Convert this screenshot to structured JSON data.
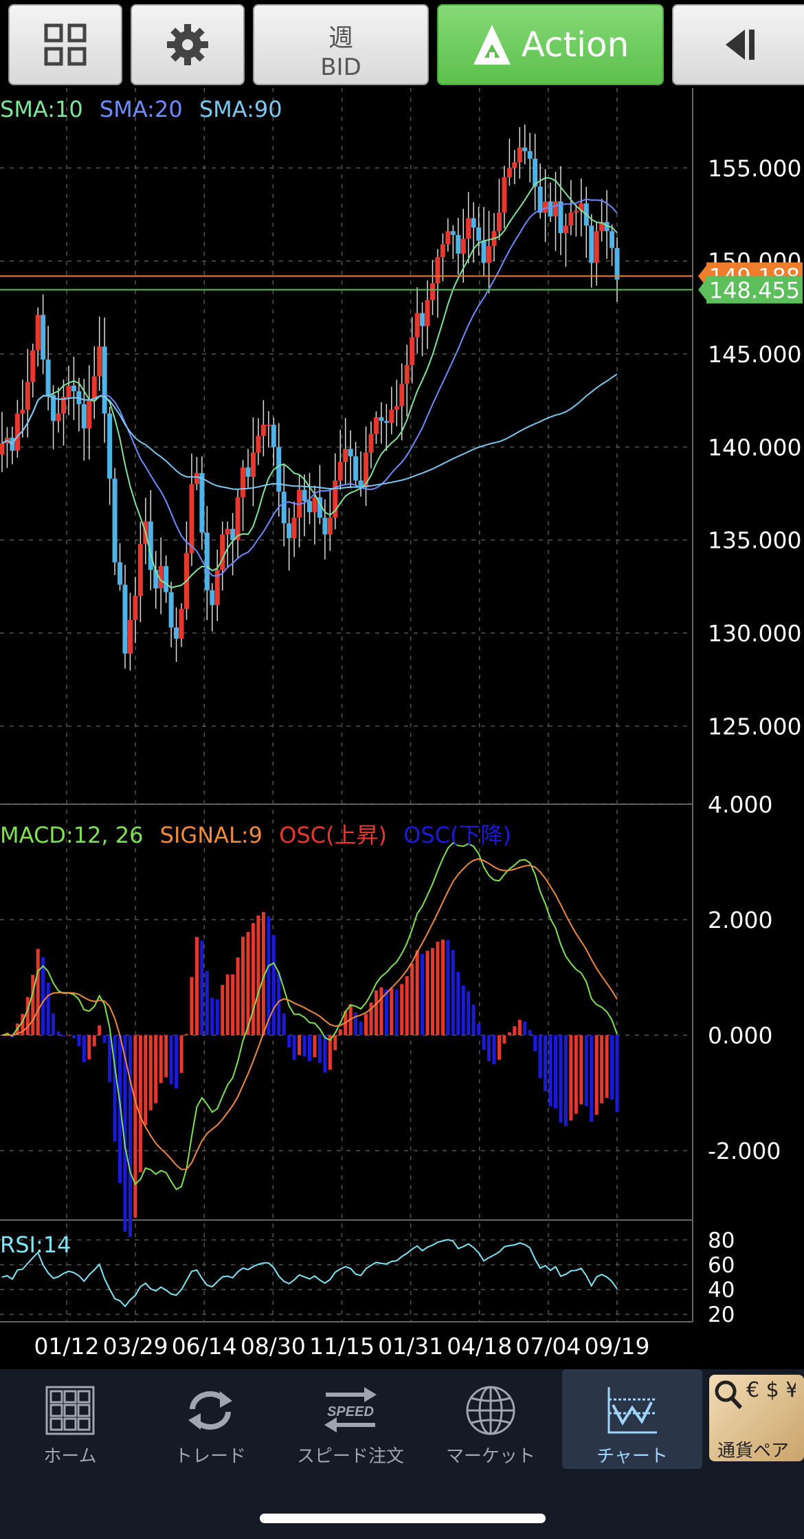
{
  "toolbar": {
    "bid_week": "週",
    "bid_side": "BID",
    "action_label": "Action"
  },
  "colors": {
    "up": "#e8382e",
    "down": "#4fb3e8",
    "sma10": "#7ee59a",
    "sma20": "#6f8cff",
    "sma90": "#7cc8f0",
    "macd": "#7fe34f",
    "signal": "#f08a3c",
    "osc_up": "#e8382e",
    "osc_down": "#1a1ad8",
    "rsi": "#7de7f7",
    "bid_line": "#f07d2c",
    "ask_line": "#5cbf5c"
  },
  "legend": {
    "sma10": "SMA:10",
    "sma20": "SMA:20",
    "sma90": "SMA:90",
    "macd": "MACD:12, 26",
    "signal": "SIGNAL:9",
    "osc_up": "OSC(上昇)",
    "osc_down": "OSC(下降)",
    "rsi": "RSI:14"
  },
  "price_tags": {
    "bid": "149.188",
    "ask": "148.455"
  },
  "chart_data": {
    "type": "candlestick",
    "price_axis": {
      "range": [
        120.8,
        159.3
      ],
      "ticks": [
        "155.000",
        "150.000",
        "145.000",
        "140.000",
        "135.000",
        "130.000",
        "125.000"
      ]
    },
    "x_labels": [
      "01/12",
      "03/29",
      "06/14",
      "08/30",
      "11/15",
      "01/31",
      "04/18",
      "07/04",
      "09/19"
    ],
    "closes": [
      140.2,
      140.5,
      139.8,
      141.8,
      142.0,
      143.5,
      145.2,
      147.1,
      144.7,
      142.8,
      141.4,
      141.8,
      142.7,
      143.3,
      143.0,
      142.3,
      141.0,
      142.5,
      143.8,
      145.4,
      141.8,
      138.3,
      133.8,
      132.6,
      128.9,
      130.7,
      132.0,
      134.8,
      136.0,
      133.4,
      132.4,
      133.6,
      132.2,
      130.3,
      129.7,
      131.3,
      134.3,
      138.0,
      138.6,
      135.4,
      132.3,
      131.5,
      133.4,
      135.3,
      135.6,
      135.0,
      137.3,
      138.9,
      138.4,
      139.7,
      140.6,
      141.2,
      141.2,
      140.0,
      137.6,
      135.9,
      135.1,
      136.2,
      137.7,
      137.1,
      136.5,
      137.3,
      136.2,
      135.3,
      136.2,
      138.2,
      139.2,
      139.9,
      139.5,
      138.2,
      137.9,
      139.7,
      140.7,
      141.6,
      141.4,
      141.3,
      142.0,
      142.2,
      143.4,
      144.4,
      145.9,
      147.2,
      146.5,
      147.9,
      148.8,
      150.2,
      150.9,
      151.6,
      151.4,
      150.4,
      151.2,
      152.3,
      151.8,
      151.1,
      149.9,
      150.8,
      151.6,
      152.6,
      154.5,
      155.0,
      155.3,
      156.1,
      155.9,
      155.5,
      154.0,
      152.6,
      153.2,
      152.4,
      153.2,
      151.5,
      151.9,
      152.6,
      152.7,
      153.1,
      151.9,
      149.9,
      151.6,
      152.1,
      151.6,
      150.7,
      149.0
    ],
    "sma_periods": [
      10,
      20,
      90
    ],
    "macd_axis": {
      "range": [
        -3.2,
        4.0
      ],
      "ticks": [
        "4.000",
        "2.000",
        "0.000",
        "-2.000"
      ]
    },
    "rsi_axis": {
      "range": [
        14,
        96
      ],
      "ticks": [
        "80",
        "60",
        "40",
        "20"
      ]
    }
  },
  "nav": {
    "home": "ホーム",
    "trade": "トレード",
    "speed": "スピード注文",
    "speed_icon_text": "SPEED",
    "market": "マーケット",
    "chart": "チャート",
    "pair": "通貨ペア",
    "pair_icon_text": "€ $ ¥"
  }
}
